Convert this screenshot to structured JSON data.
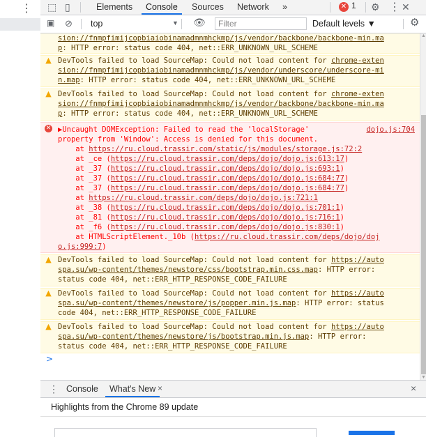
{
  "page_left": {
    "menu_icon": "vertical-dots-icon"
  },
  "tabs": {
    "items": [
      "Elements",
      "Console",
      "Sources",
      "Network"
    ],
    "active": "Console",
    "more": "»",
    "error_count": "1"
  },
  "toolbar": {
    "context": "top",
    "filter_placeholder": "Filter",
    "levels": "Default levels ▼"
  },
  "messages": [
    {
      "level": "warn",
      "lines": [
        "sion://fnmpfimijcopbiaiobinamadmnmhckmp/js/vendor/backbone/backbone-min.ma",
        "p: HTTP error: status code 404, net::ERR_UNKNOWN_URL_SCHEME"
      ]
    },
    {
      "level": "warn",
      "lines": [
        "DevTools failed to load SourceMap: Could not load content for chrome-exten",
        "sion://fnmpfimijcopbiaiobinamadmnmhckmp/js/vendor/underscore/underscore-mi",
        "n.map: HTTP error: status code 404, net::ERR_UNKNOWN_URL_SCHEME"
      ]
    },
    {
      "level": "warn",
      "lines": [
        "DevTools failed to load SourceMap: Could not load content for chrome-exten",
        "sion://fnmpfimijcopbiaiobinamadmnmhckmp/js/vendor/backbone/backbone-min.ma",
        "p: HTTP error: status code 404, net::ERR_UNKNOWN_URL_SCHEME"
      ]
    },
    {
      "level": "error",
      "source": "dojo.js:704",
      "lines": [
        "▶Uncaught DOMException: Failed to read the 'localStorage'",
        "property from 'Window': Access is denied for this document.",
        "    at https://ru.cloud.trassir.com/static/js/modules/storage.js:72:2",
        "    at _ce (https://ru.cloud.trassir.com/deps/dojo/dojo.js:613:17)",
        "    at _37 (https://ru.cloud.trassir.com/deps/dojo/dojo.js:693:1)",
        "    at _37 (https://ru.cloud.trassir.com/deps/dojo/dojo.js:684:77)",
        "    at _37 (https://ru.cloud.trassir.com/deps/dojo/dojo.js:684:77)",
        "    at https://ru.cloud.trassir.com/deps/dojo/dojo.js:721:1",
        "    at _38 (https://ru.cloud.trassir.com/deps/dojo/dojo.js:701:1)",
        "    at _81 (https://ru.cloud.trassir.com/deps/dojo/dojo.js:716:1)",
        "    at _f6 (https://ru.cloud.trassir.com/deps/dojo/dojo.js:830:1)",
        "    at HTMLScriptElement._10b (https://ru.cloud.trassir.com/deps/dojo/doj",
        "o.js:999:7)"
      ]
    },
    {
      "level": "warn",
      "lines": [
        "DevTools failed to load SourceMap: Could not load content for https://auto",
        "spa.su/wp-content/themes/newstore/css/bootstrap.min.css.map: HTTP error:",
        "status code 404, net::ERR_HTTP_RESPONSE_CODE_FAILURE"
      ]
    },
    {
      "level": "warn",
      "lines": [
        "DevTools failed to load SourceMap: Could not load content for https://auto",
        "spa.su/wp-content/themes/newstore/js/popper.min.js.map: HTTP error: status",
        "code 404, net::ERR_HTTP_RESPONSE_CODE_FAILURE"
      ]
    },
    {
      "level": "warn",
      "lines": [
        "DevTools failed to load SourceMap: Could not load content for https://auto",
        "spa.su/wp-content/themes/newstore/js/bootstrap.min.js.map: HTTP error:",
        "status code 404, net::ERR_HTTP_RESPONSE_CODE_FAILURE"
      ]
    }
  ],
  "console_prompt": ">",
  "drawer": {
    "tabs": [
      "Console",
      "What's New"
    ],
    "active": "What's New",
    "close_tab": "×",
    "close": "×",
    "highlights": "Highlights from the Chrome 89 update"
  },
  "colors": {
    "warn_bg": "#fffbe5",
    "error_bg": "#fff0f0",
    "error_text": "#ff0000",
    "accent": "#1a73e8"
  }
}
